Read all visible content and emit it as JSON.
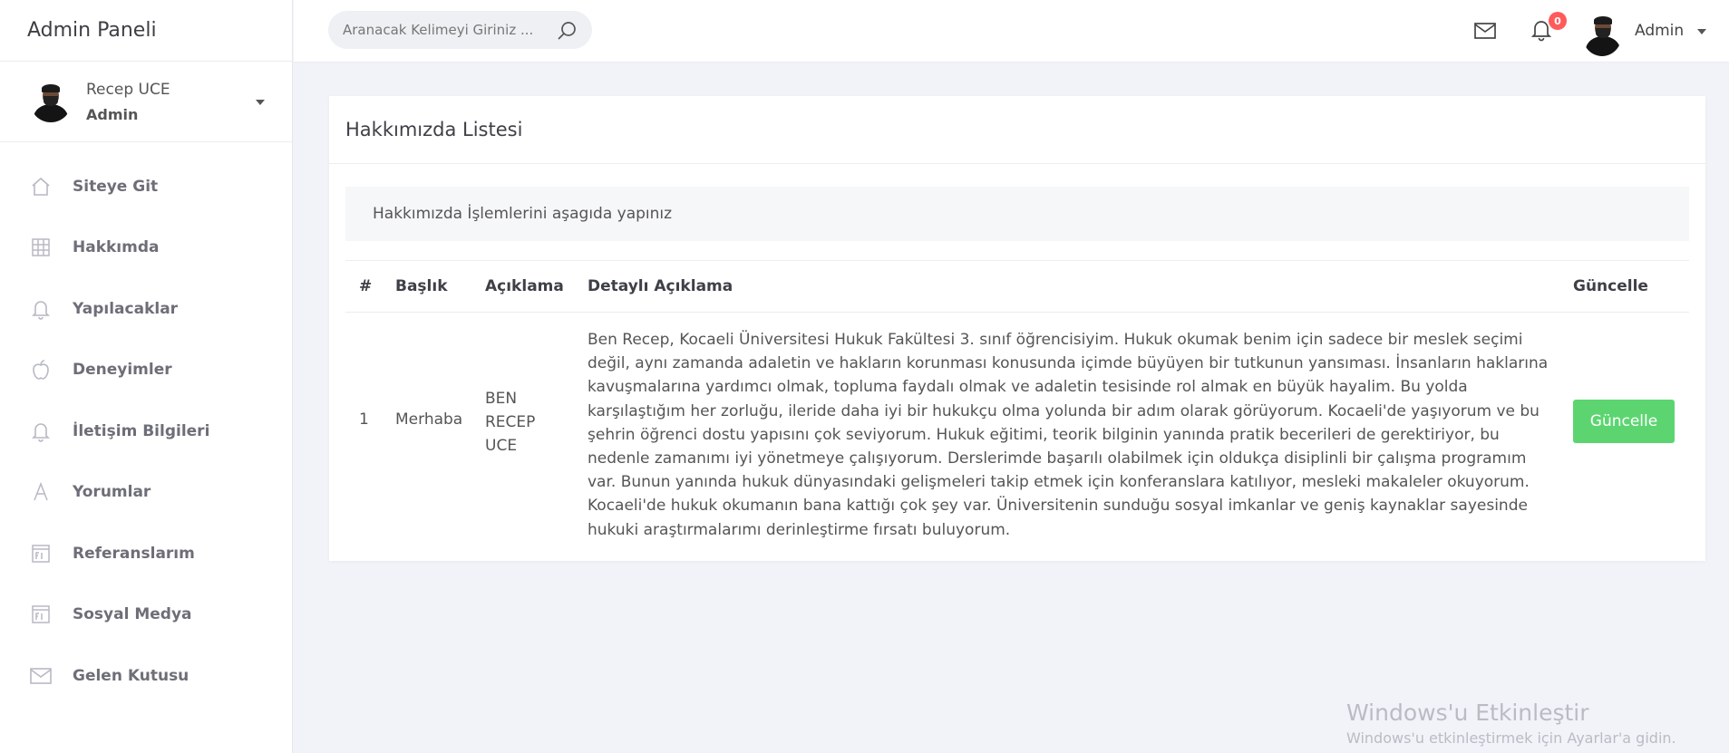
{
  "sidebar": {
    "brand": "Admin Paneli",
    "profile": {
      "name": "Recep UCE",
      "role": "Admin"
    },
    "items": [
      {
        "label": "Siteye Git",
        "icon": "home-icon"
      },
      {
        "label": "Hakkımda",
        "icon": "grid-icon"
      },
      {
        "label": "Yapılacaklar",
        "icon": "bell-icon"
      },
      {
        "label": "Deneyimler",
        "icon": "apple-icon"
      },
      {
        "label": "İletişim Bilgileri",
        "icon": "bell-icon"
      },
      {
        "label": "Yorumlar",
        "icon": "font-icon"
      },
      {
        "label": "Referanslarım",
        "icon": "fi-icon"
      },
      {
        "label": "Sosyal Medya",
        "icon": "fi-icon"
      },
      {
        "label": "Gelen Kutusu",
        "icon": "mail-icon"
      }
    ]
  },
  "topbar": {
    "search_placeholder": "Aranacak Kelimeyi Giriniz ...",
    "notification_count": "0",
    "user_name": "Admin"
  },
  "main": {
    "card_title": "Hakkımızda Listesi",
    "alert_text": "Hakkımızda İşlemlerini aşagıda yapınız",
    "table": {
      "headers": [
        "#",
        "Başlık",
        "Açıklama",
        "Detaylı Açıklama",
        "Güncelle"
      ],
      "rows": [
        {
          "id": "1",
          "title": "Merhaba",
          "description": "BEN RECEP UCE",
          "detail": "Ben Recep, Kocaeli Üniversitesi Hukuk Fakültesi 3. sınıf öğrencisiyim. Hukuk okumak benim için sadece bir meslek seçimi değil, aynı zamanda adaletin ve hakların korunması konusunda içimde büyüyen bir tutkunun yansıması. İnsanların haklarına kavuşmalarına yardımcı olmak, topluma faydalı olmak ve adaletin tesisinde rol almak en büyük hayalim. Bu yolda karşılaştığım her zorluğu, ileride daha iyi bir hukukçu olma yolunda bir adım olarak görüyorum. Kocaeli'de yaşıyorum ve bu şehrin öğrenci dostu yapısını çok seviyorum. Hukuk eğitimi, teorik bilginin yanında pratik becerileri de gerektiriyor, bu nedenle zamanımı iyi yönetmeye çalışıyorum. Derslerimde başarılı olabilmek için oldukça disiplinli bir çalışma programım var. Bunun yanında hukuk dünyasındaki gelişmeleri takip etmek için konferanslara katılıyor, mesleki makaleler okuyorum. Kocaeli'de hukuk okumanın bana kattığı çok şey var. Üniversitenin sunduğu sosyal imkanlar ve geniş kaynaklar sayesinde hukuki araştırmalarımı derinleştirme fırsatı buluyorum.",
          "button_label": "Güncelle"
        }
      ]
    }
  },
  "watermark": {
    "title": "Windows'u Etkinleştir",
    "subtitle": "Windows'u etkinleştirmek için Ayarlar'a gidin."
  },
  "colors": {
    "update_button": "#5cd571",
    "badge": "#ff5b5b",
    "background": "#f2f3f8"
  }
}
